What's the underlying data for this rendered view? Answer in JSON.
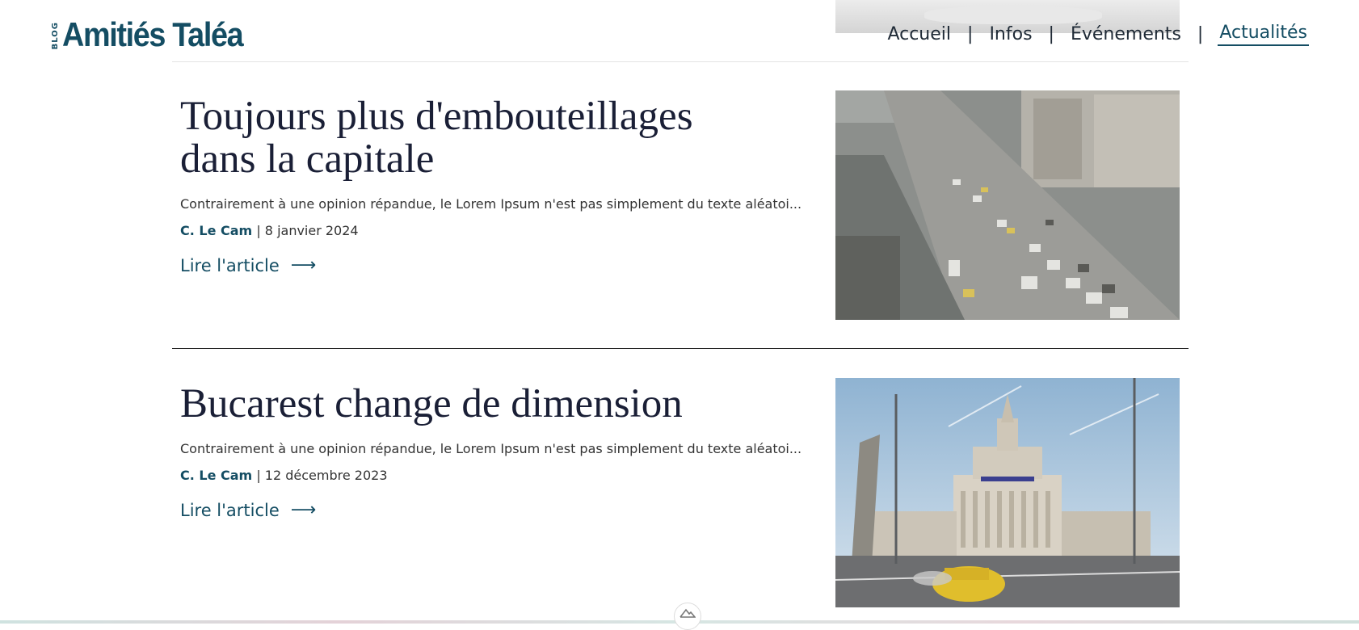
{
  "header": {
    "logo_small": "BLOG",
    "logo_text": "Amitiés Taléa",
    "nav": [
      {
        "label": "Accueil",
        "active": false
      },
      {
        "label": "Infos",
        "active": false
      },
      {
        "label": "Événements",
        "active": false
      },
      {
        "label": "Actualités",
        "active": true
      }
    ],
    "nav_separator": "|"
  },
  "articles": [
    {
      "title": "Toujours plus d'embouteillages dans la capitale",
      "excerpt": "Contrairement à une opinion répandue, le Lorem Ipsum n'est pas simplement du texte aléatoi...",
      "author": "C. Le Cam",
      "meta_separator": "|",
      "date": "8 janvier 2024",
      "cta": "Lire l'article",
      "arrow": "⟶",
      "image": "traffic-boulevard-photo"
    },
    {
      "title": "Bucarest change de dimension",
      "excerpt": "Contrairement à une opinion répandue, le Lorem Ipsum n'est pas simplement du texte aléatoi...",
      "author": "C. Le Cam",
      "meta_separator": "|",
      "date": "12 décembre 2023",
      "cta": "Lire l'article",
      "arrow": "⟶",
      "image": "press-house-building-photo"
    }
  ],
  "floating_button_icon": "mountain-icon",
  "colors": {
    "brand": "#144d63",
    "title": "#1a1f36",
    "text": "#333333"
  }
}
